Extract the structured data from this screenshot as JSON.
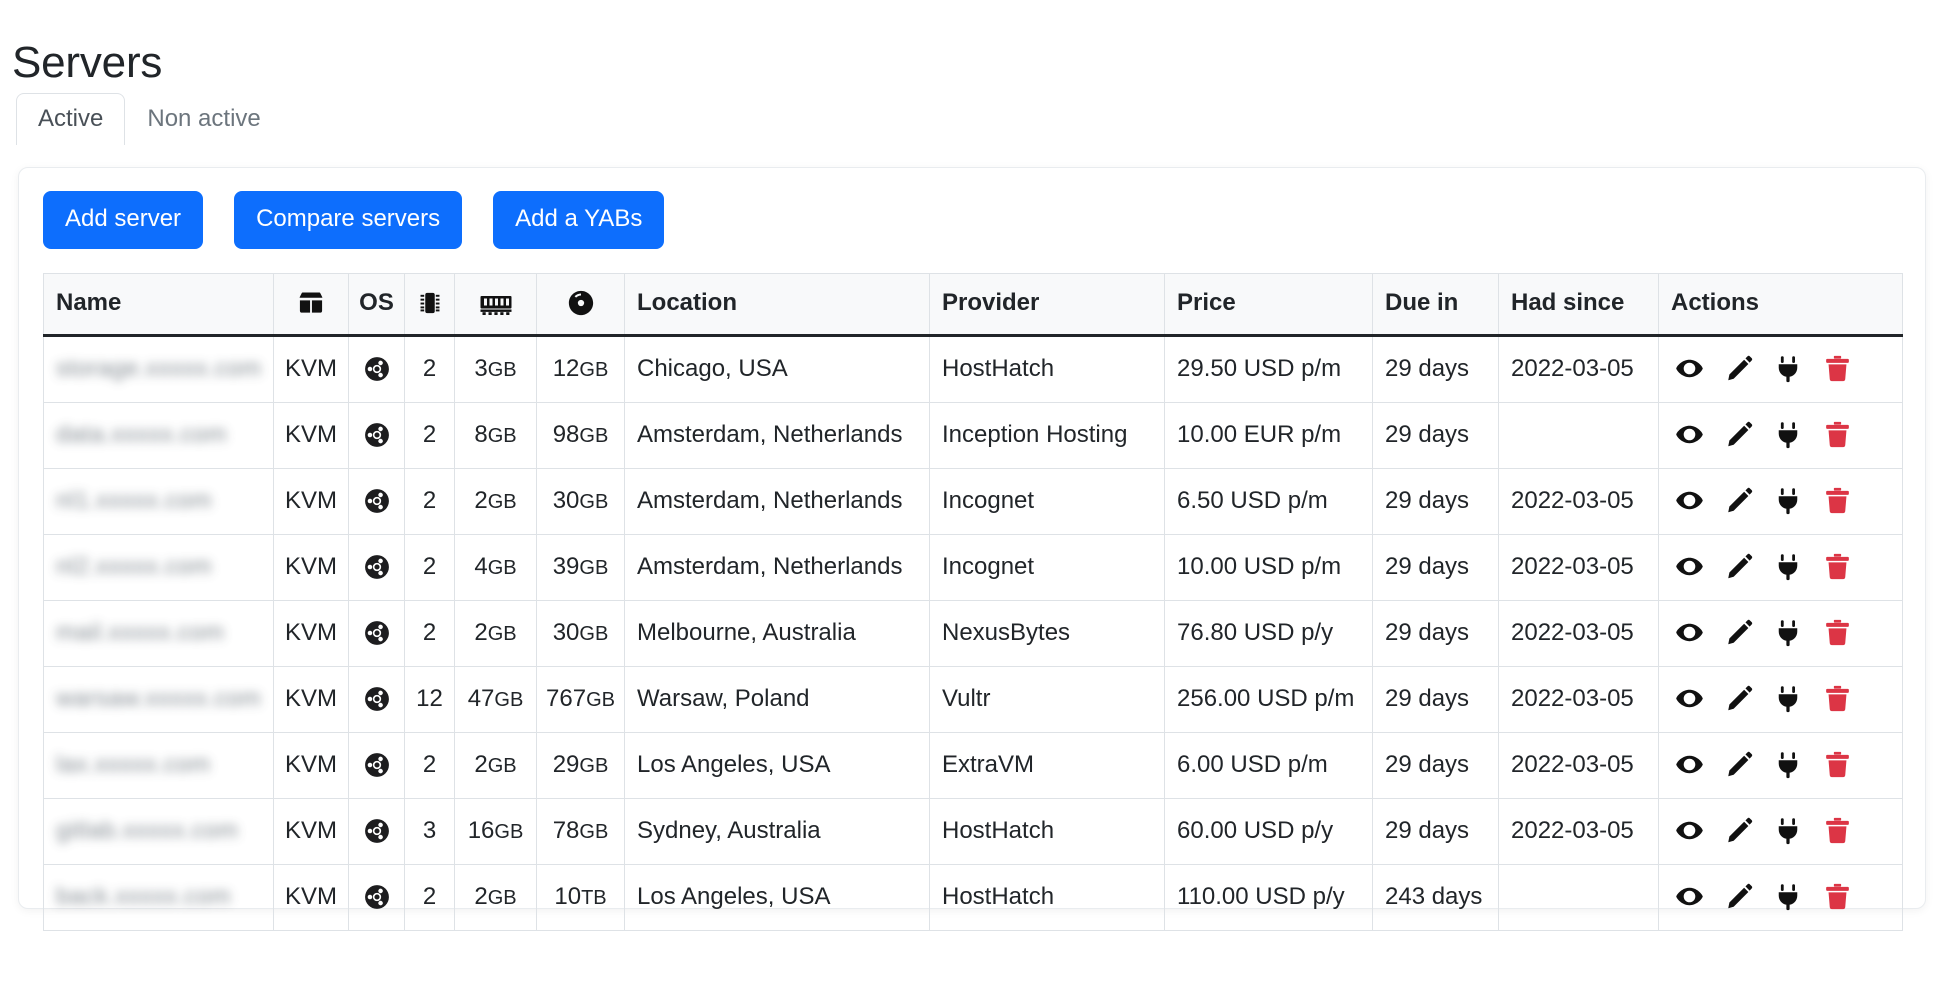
{
  "page": {
    "title": "Servers"
  },
  "tabs": [
    {
      "label": "Active",
      "active": true
    },
    {
      "label": "Non active",
      "active": false
    }
  ],
  "toolbar": {
    "add_server_label": "Add server",
    "compare_servers_label": "Compare servers",
    "add_yabs_label": "Add a YABs",
    "button_color": "#0d6efd"
  },
  "table": {
    "headers": {
      "name": "Name",
      "virtualization": "",
      "os": "OS",
      "cpu": "",
      "ram": "",
      "disk": "",
      "location": "Location",
      "provider": "Provider",
      "price": "Price",
      "due_in": "Due in",
      "had_since": "Had since",
      "actions": "Actions"
    },
    "header_icons": {
      "virtualization": "box-icon",
      "cpu": "microchip-icon",
      "ram": "memory-icon",
      "disk": "disc-icon"
    },
    "action_icons": [
      "eye-icon",
      "pencil-icon",
      "power-plug-icon",
      "trash-icon"
    ],
    "action_trash_color": "#dc3545",
    "rows": [
      {
        "name": "storage.xxxxx.com",
        "virtualization": "KVM",
        "os": "ubuntu-icon",
        "cpu": "2",
        "ram": "3",
        "ram_unit": "GB",
        "disk": "12",
        "disk_unit": "GB",
        "location": "Chicago, USA",
        "provider": "HostHatch",
        "price": "29.50 USD p/m",
        "due_in": "29 days",
        "had_since": "2022-03-05"
      },
      {
        "name": "data.xxxxx.com",
        "virtualization": "KVM",
        "os": "ubuntu-icon",
        "cpu": "2",
        "ram": "8",
        "ram_unit": "GB",
        "disk": "98",
        "disk_unit": "GB",
        "location": "Amsterdam, Netherlands",
        "provider": "Inception Hosting",
        "price": "10.00 EUR p/m",
        "due_in": "29 days",
        "had_since": ""
      },
      {
        "name": "nl1.xxxxx.com",
        "virtualization": "KVM",
        "os": "ubuntu-icon",
        "cpu": "2",
        "ram": "2",
        "ram_unit": "GB",
        "disk": "30",
        "disk_unit": "GB",
        "location": "Amsterdam, Netherlands",
        "provider": "Incognet",
        "price": "6.50 USD p/m",
        "due_in": "29 days",
        "had_since": "2022-03-05"
      },
      {
        "name": "nl2.xxxxx.com",
        "virtualization": "KVM",
        "os": "ubuntu-icon",
        "cpu": "2",
        "ram": "4",
        "ram_unit": "GB",
        "disk": "39",
        "disk_unit": "GB",
        "location": "Amsterdam, Netherlands",
        "provider": "Incognet",
        "price": "10.00 USD p/m",
        "due_in": "29 days",
        "had_since": "2022-03-05"
      },
      {
        "name": "mail.xxxxx.com",
        "virtualization": "KVM",
        "os": "ubuntu-icon",
        "cpu": "2",
        "ram": "2",
        "ram_unit": "GB",
        "disk": "30",
        "disk_unit": "GB",
        "location": "Melbourne, Australia",
        "provider": "NexusBytes",
        "price": "76.80 USD p/y",
        "due_in": "29 days",
        "had_since": "2022-03-05"
      },
      {
        "name": "warsaw.xxxxx.com",
        "virtualization": "KVM",
        "os": "ubuntu-icon",
        "cpu": "12",
        "ram": "47",
        "ram_unit": "GB",
        "disk": "767",
        "disk_unit": "GB",
        "location": "Warsaw, Poland",
        "provider": "Vultr",
        "price": "256.00 USD p/m",
        "due_in": "29 days",
        "had_since": "2022-03-05"
      },
      {
        "name": "lax.xxxxx.com",
        "virtualization": "KVM",
        "os": "ubuntu-icon",
        "cpu": "2",
        "ram": "2",
        "ram_unit": "GB",
        "disk": "29",
        "disk_unit": "GB",
        "location": "Los Angeles, USA",
        "provider": "ExtraVM",
        "price": "6.00 USD p/m",
        "due_in": "29 days",
        "had_since": "2022-03-05"
      },
      {
        "name": "gitlab.xxxxx.com",
        "virtualization": "KVM",
        "os": "ubuntu-icon",
        "cpu": "3",
        "ram": "16",
        "ram_unit": "GB",
        "disk": "78",
        "disk_unit": "GB",
        "location": "Sydney, Australia",
        "provider": "HostHatch",
        "price": "60.00 USD p/y",
        "due_in": "29 days",
        "had_since": "2022-03-05"
      },
      {
        "name": "back.xxxxx.com",
        "virtualization": "KVM",
        "os": "ubuntu-icon",
        "cpu": "2",
        "ram": "2",
        "ram_unit": "GB",
        "disk": "10",
        "disk_unit": "TB",
        "location": "Los Angeles, USA",
        "provider": "HostHatch",
        "price": "110.00 USD p/y",
        "due_in": "243 days",
        "had_since": ""
      }
    ]
  }
}
